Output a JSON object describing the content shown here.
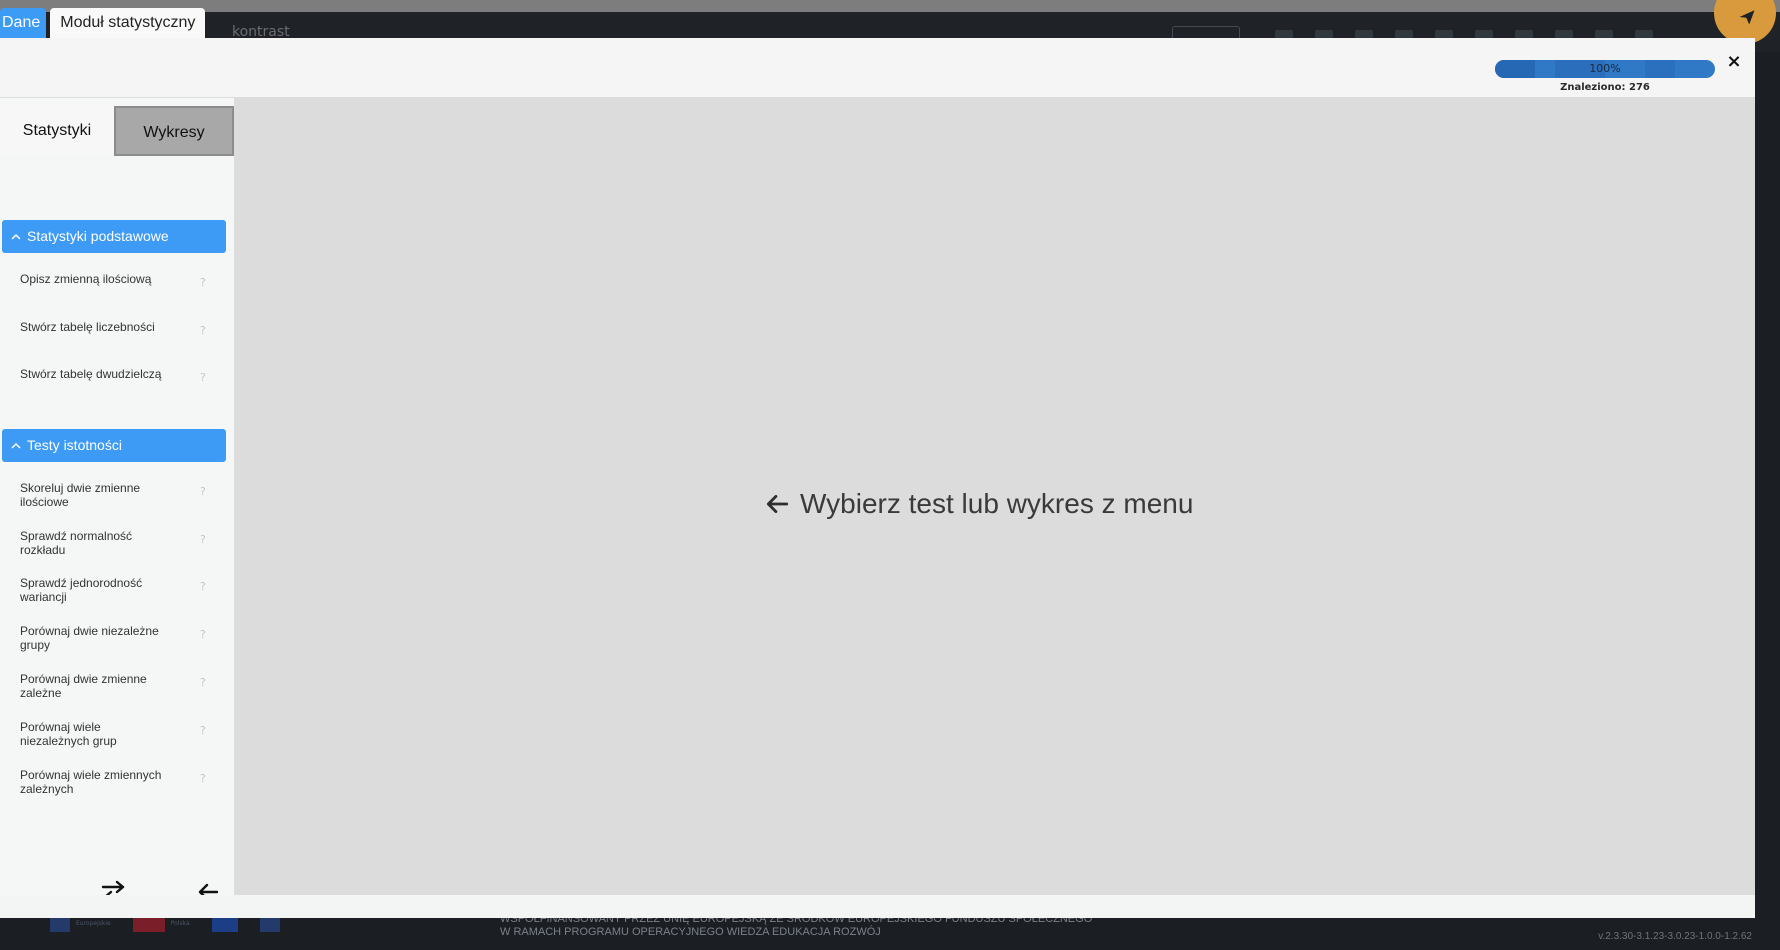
{
  "background_app": {
    "header_partial_text": "kontrast",
    "footer_text_line1": "WSPÓŁFINANSOWANY PRZEZ UNIĘ EUROPEJSKĄ ZE ŚRODKÓW EUROPEJSKIEGO FUNDUSZU SPOŁECZNEGO",
    "footer_text_line2": "W RAMACH PROGRAMU OPERACYJNEGO WIEDZA EDUKACJA ROZWÓJ",
    "version": "v.2.3.30-3.1.23-3.0.23-1.0.0-1.2.62",
    "logos": [
      "Europejskie",
      "Polska"
    ]
  },
  "top_tabs": [
    {
      "label": "Dane"
    },
    {
      "label": "Moduł statystyczny"
    }
  ],
  "progress": {
    "label": "100%",
    "value": 1.0
  },
  "found": "Znaleziono: 276",
  "close_label": "×",
  "sidebar": {
    "tabs": [
      {
        "label": "Statystyki",
        "active": true
      },
      {
        "label": "Wykresy",
        "active": false
      }
    ],
    "sections": [
      {
        "title": "Statystyki podstawowe",
        "items": [
          {
            "label": "Opisz zmienną ilościową",
            "help": "?"
          },
          {
            "label": "Stwórz tabelę liczebności",
            "help": "?"
          },
          {
            "label": "Stwórz tabelę dwudzielczą",
            "help": "?"
          }
        ]
      },
      {
        "title": "Testy istotności",
        "items": [
          {
            "label": "Skoreluj dwie zmienne ilościowe",
            "help": "?"
          },
          {
            "label": "Sprawdź normalność rozkładu",
            "help": "?"
          },
          {
            "label": "Sprawdź jednorodność wariancji",
            "help": "?"
          },
          {
            "label": "Porównaj dwie niezależne grupy",
            "help": "?"
          },
          {
            "label": "Porównaj dwie zmienne zależne",
            "help": "?"
          },
          {
            "label": "Porównaj wiele niezależnych grup",
            "help": "?"
          },
          {
            "label": "Porównaj wiele zmiennych zależnych",
            "help": "?"
          }
        ]
      }
    ],
    "bottom_icons": [
      "swap-icon",
      "arrow-left-icon"
    ]
  },
  "main": {
    "message": "Wybierz test lub wykres z menu",
    "icon": "arrow-left-icon"
  },
  "colors": {
    "accent": "#3d9bf6",
    "progress": "#2f79c6",
    "main_bg": "#dcdcdc",
    "fab": "#d99a3e"
  }
}
